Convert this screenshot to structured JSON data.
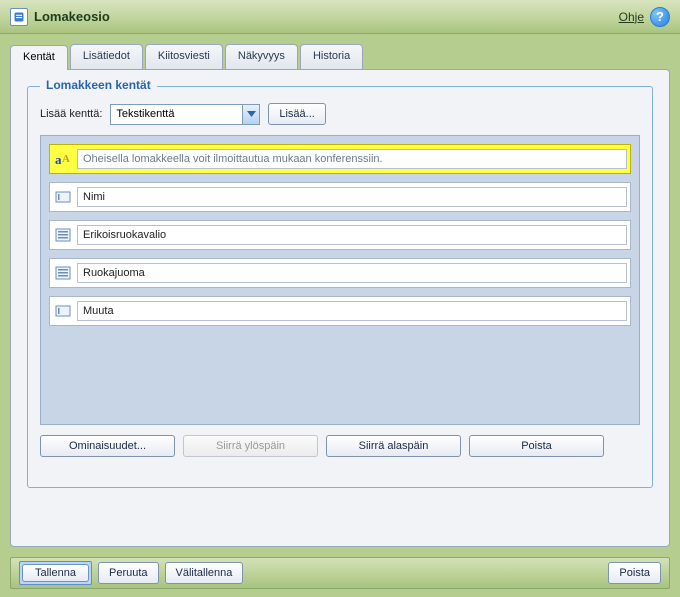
{
  "titlebar": {
    "title": "Lomakeosio",
    "help_label": "Ohje"
  },
  "tabs": [
    {
      "label": "Kentät",
      "active": true
    },
    {
      "label": "Lisätiedot",
      "active": false
    },
    {
      "label": "Kiitosviesti",
      "active": false
    },
    {
      "label": "Näkyvyys",
      "active": false
    },
    {
      "label": "Historia",
      "active": false
    }
  ],
  "fieldset": {
    "legend": "Lomakkeen kentät",
    "add_label": "Lisää kenttä:",
    "field_type_selected": "Tekstikenttä",
    "add_button": "Lisää..."
  },
  "fields": [
    {
      "icon": "text-style-icon",
      "value": "Oheisella lomakkeella voit ilmoittautua mukaan konferenssiin.",
      "selected": true
    },
    {
      "icon": "text-input-icon",
      "value": "Nimi",
      "selected": false
    },
    {
      "icon": "select-list-icon",
      "value": "Erikoisruokavalio",
      "selected": false
    },
    {
      "icon": "select-list-icon",
      "value": "Ruokajuoma",
      "selected": false
    },
    {
      "icon": "text-input-icon",
      "value": "Muuta",
      "selected": false
    }
  ],
  "actions": {
    "properties": "Ominaisuudet...",
    "move_up": "Siirrä ylöspäin",
    "move_down": "Siirrä alaspäin",
    "delete": "Poista",
    "move_up_disabled": true
  },
  "bottom": {
    "save": "Tallenna",
    "cancel": "Peruuta",
    "save_draft": "Välitallenna",
    "delete": "Poista"
  }
}
